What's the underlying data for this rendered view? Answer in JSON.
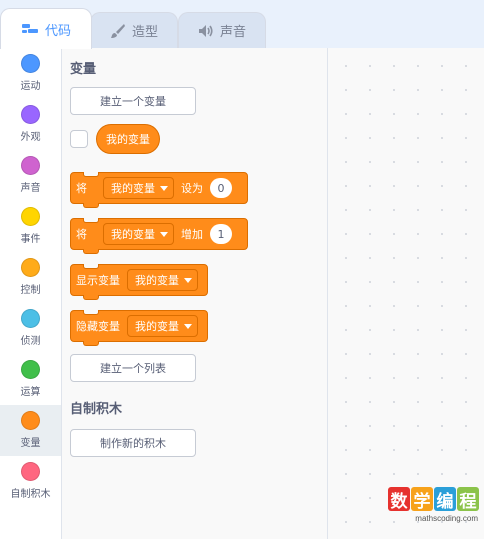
{
  "tabs": [
    {
      "label": "代码",
      "icon": "code-icon",
      "active": true
    },
    {
      "label": "造型",
      "icon": "brush-icon",
      "active": false
    },
    {
      "label": "声音",
      "icon": "speaker-icon",
      "active": false
    }
  ],
  "categories": [
    {
      "label": "运动",
      "color": "#4c97ff",
      "selected": false
    },
    {
      "label": "外观",
      "color": "#9966ff",
      "selected": false
    },
    {
      "label": "声音",
      "color": "#cf63cf",
      "selected": false
    },
    {
      "label": "事件",
      "color": "#ffd500",
      "selected": false
    },
    {
      "label": "控制",
      "color": "#ffab19",
      "selected": false
    },
    {
      "label": "侦测",
      "color": "#4cbfe6",
      "selected": false
    },
    {
      "label": "运算",
      "color": "#40bf4a",
      "selected": false
    },
    {
      "label": "变量",
      "color": "#ff8c1a",
      "selected": true
    },
    {
      "label": "自制积木",
      "color": "#ff6680",
      "selected": false
    }
  ],
  "palette": {
    "variables_title": "变量",
    "make_variable_button": "建立一个变量",
    "variable_reporter": "我的变量",
    "set_block": {
      "prefix": "将",
      "dropdown": "我的变量",
      "middle": "设为",
      "value": "0"
    },
    "change_block": {
      "prefix": "将",
      "dropdown": "我的变量",
      "middle": "增加",
      "value": "1"
    },
    "show_block": {
      "label": "显示变量",
      "dropdown": "我的变量"
    },
    "hide_block": {
      "label": "隐藏变量",
      "dropdown": "我的变量"
    },
    "make_list_button": "建立一个列表",
    "my_blocks_title": "自制积木",
    "make_block_button": "制作新的积木"
  },
  "watermark": {
    "chars": [
      "数",
      "学",
      "编",
      "程"
    ],
    "char_colors": [
      "#e6322e",
      "#f7a21b",
      "#2a9fd8",
      "#8bc34a"
    ],
    "url": "mathscoding.com"
  },
  "colors": {
    "accent": "#4c97ff",
    "variables": "#ff8c1a",
    "variables_border": "#db6e00"
  }
}
